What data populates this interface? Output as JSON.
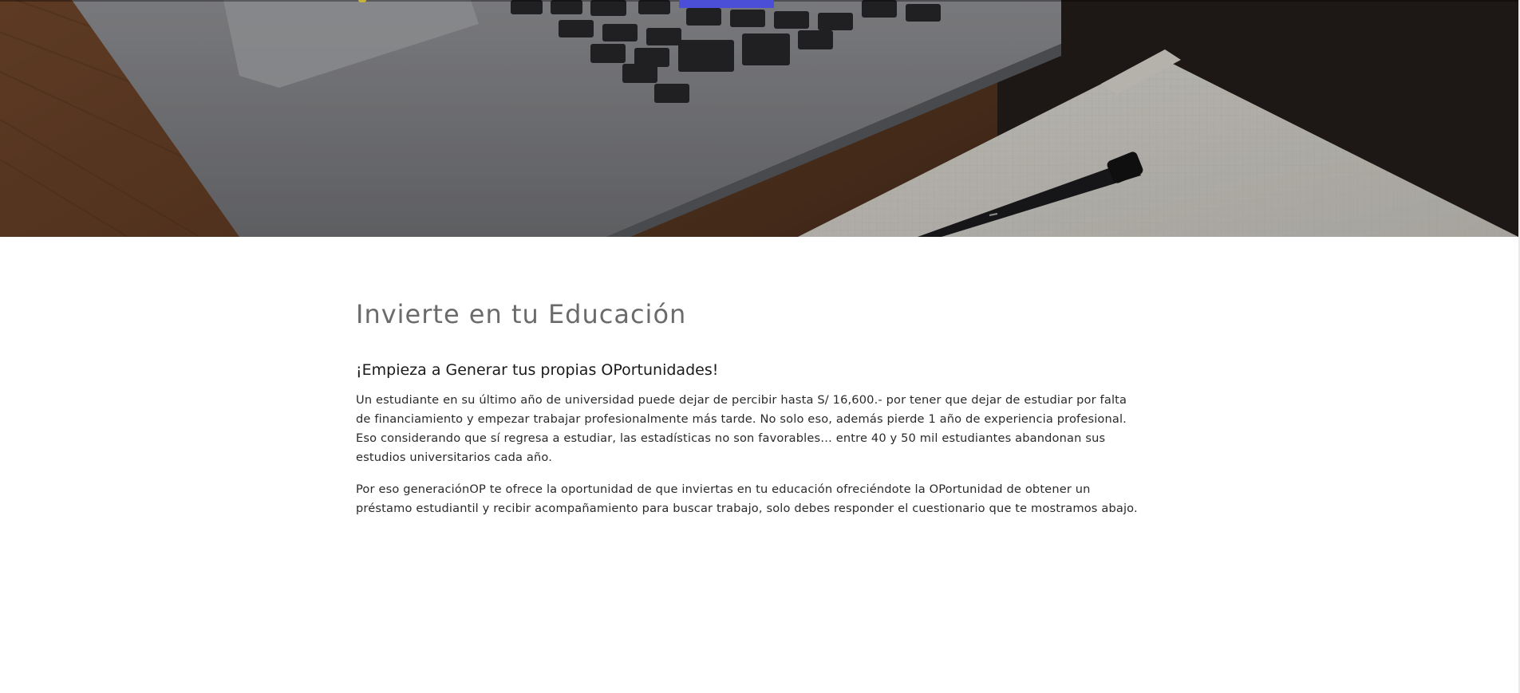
{
  "hero": {
    "image_description": "laptop-keyboard-notebook-pen-photo"
  },
  "main": {
    "title": "Invierte en tu Educación",
    "subtitle": "¡Empieza a Generar tus propias OPortunidades!",
    "paragraphs": [
      "Un estudiante en su último año de universidad puede dejar de percibir hasta S/ 16,600.- por tener que dejar de estudiar por falta de financiamiento y empezar trabajar profesionalmente más tarde. No solo eso, además pierde 1 año de experiencia profesional. Eso considerando que sí regresa a estudiar, las estadísticas no son favorables… entre 40 y 50 mil estudiantes abandonan sus estudios universitarios cada año.",
      "Por eso generaciónOP te ofrece la oportunidad de que inviertas en tu educación ofreciéndote la OPortunidad de obtener un préstamo estudiantil y recibir acompañamiento para buscar trabajo, solo debes responder el cuestionario que te mostramos abajo."
    ]
  },
  "colors": {
    "accent_button": "#4b4ed6",
    "title": "#6b6b6b",
    "body_text": "#2a2a2a"
  }
}
